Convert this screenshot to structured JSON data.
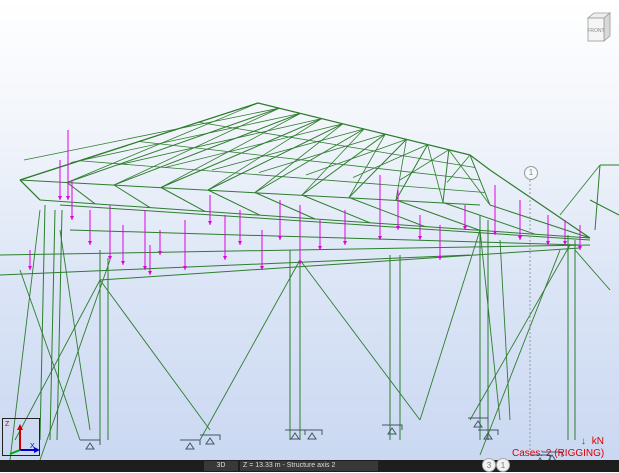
{
  "viewcube": {
    "face_label": "FRONT"
  },
  "axis_marker": {
    "top_label": "1"
  },
  "legend": {
    "cases_text": "Cases: 2 (RIGGING)",
    "unit": "kN",
    "arrow": "↓"
  },
  "status_bar": {
    "view_mode": "3D",
    "info": "Z = 13.33 m - Structure axis 2",
    "page_numbers": [
      "3",
      "1"
    ]
  },
  "triad": {
    "z_label": "Z",
    "x_label": "X"
  },
  "colors": {
    "members": "#2e7d2e",
    "loads": "#e000e0",
    "supports": "#445566",
    "cases_text": "#e00000"
  }
}
